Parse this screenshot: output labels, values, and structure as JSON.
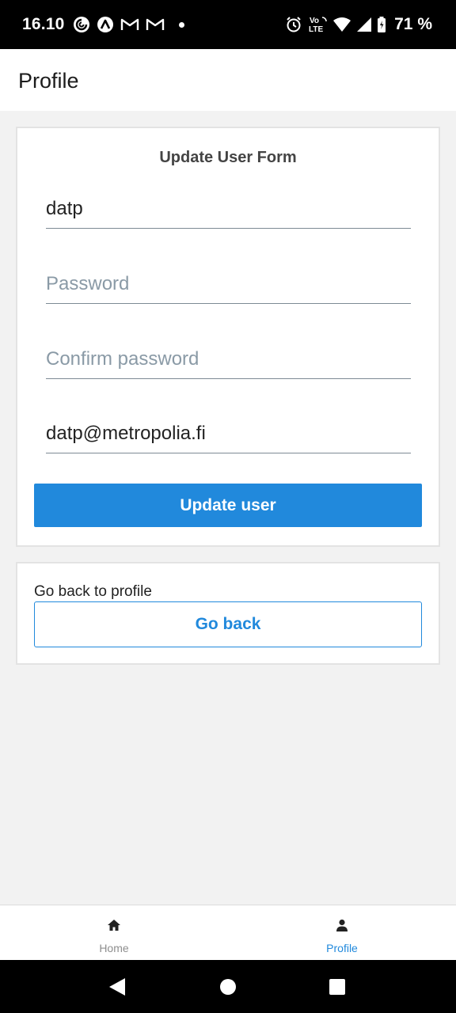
{
  "status_bar": {
    "time": "16.10",
    "battery": "71 %",
    "left_icons": [
      "pocket-casts-icon",
      "arc-icon",
      "gmail-icon",
      "gmail-icon",
      "dot-icon"
    ],
    "right_icons": [
      "alarm-icon",
      "volte-icon",
      "wifi-icon",
      "signal-icon",
      "battery-icon"
    ],
    "volte_top": "Vo",
    "volte_bottom": "LTE"
  },
  "header": {
    "title": "Profile"
  },
  "form": {
    "title": "Update User Form",
    "username_value": "datp",
    "password_placeholder": "Password",
    "confirm_placeholder": "Confirm password",
    "email_value": "datp@metropolia.fi",
    "submit_label": "Update user"
  },
  "back_card": {
    "label": "Go back to profile",
    "button_label": "Go back"
  },
  "tab_bar": {
    "tabs": [
      {
        "label": "Home",
        "icon": "home-icon",
        "active": false
      },
      {
        "label": "Profile",
        "icon": "person-icon",
        "active": true
      }
    ]
  },
  "nav_bar": {
    "buttons": [
      "back-triangle-icon",
      "home-circle-icon",
      "recents-square-icon"
    ]
  },
  "colors": {
    "accent": "#2189dc",
    "background": "#f2f2f2",
    "status_bar": "#000000"
  }
}
